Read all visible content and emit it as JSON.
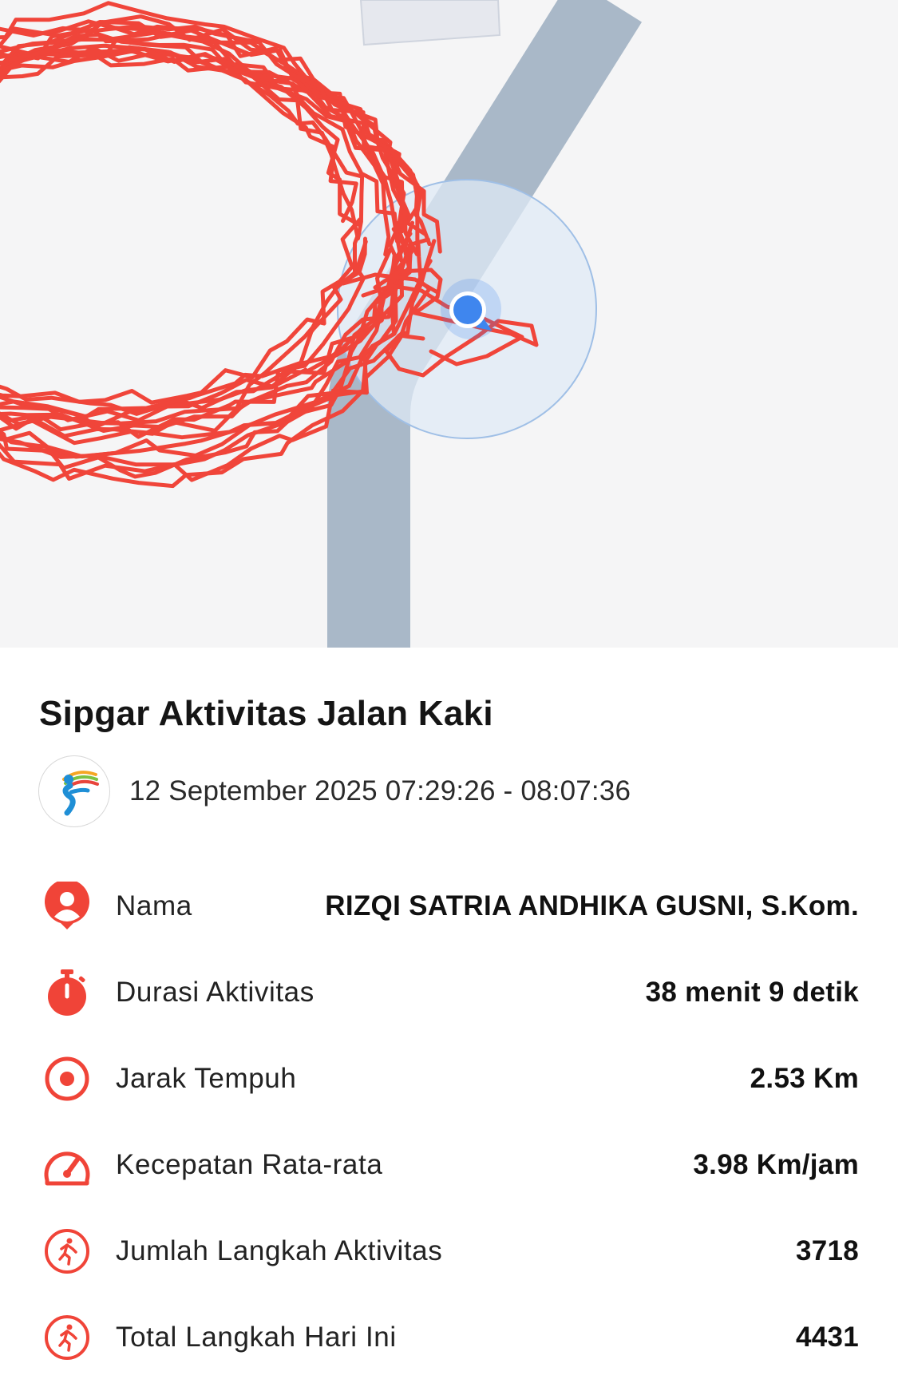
{
  "colors": {
    "accent": "#f04438",
    "track": "#f0453a",
    "road": "#a9b8c8",
    "location_dot": "#3f86ee",
    "accuracy_circle": "#dfe9f5",
    "map_bg": "#f5f5f6"
  },
  "map": {
    "icons": [
      "location-dot-icon",
      "accuracy-circle"
    ]
  },
  "activity": {
    "title": "Sipgar Aktivitas Jalan Kaki",
    "date_range": "12 September 2025 07:29:26 - 08:07:36",
    "logo_icon": "runner-logo-icon"
  },
  "stats": [
    {
      "icon": "user-pin-icon",
      "label": "Nama",
      "value": "RIZQI SATRIA ANDHIKA GUSNI, S.Kom."
    },
    {
      "icon": "stopwatch-icon",
      "label": "Durasi Aktivitas",
      "value": "38 menit 9 detik"
    },
    {
      "icon": "target-icon",
      "label": "Jarak Tempuh",
      "value": "2.53 Km"
    },
    {
      "icon": "speedometer-icon",
      "label": "Kecepatan Rata-rata",
      "value": "3.98 Km/jam"
    },
    {
      "icon": "running-person-icon",
      "label": "Jumlah Langkah Aktivitas",
      "value": "3718"
    },
    {
      "icon": "running-person-icon",
      "label": "Total Langkah Hari Ini",
      "value": "4431"
    }
  ]
}
